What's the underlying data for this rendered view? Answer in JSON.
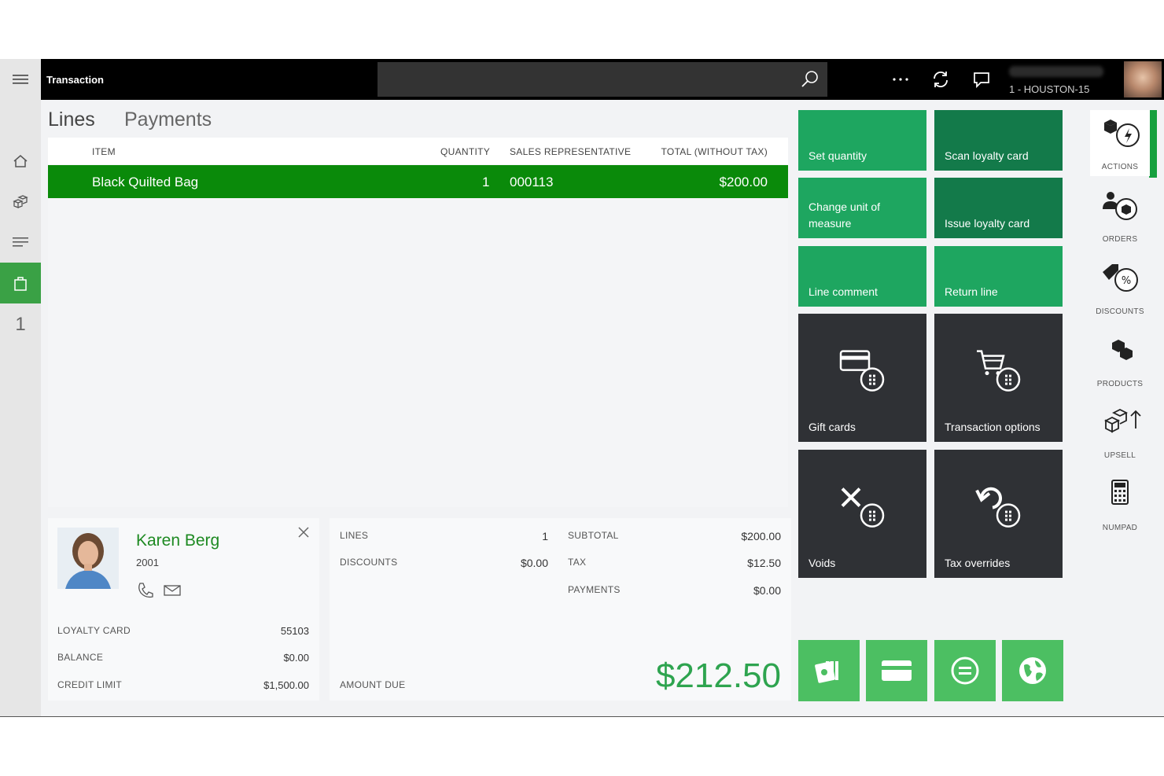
{
  "header": {
    "title": "Transaction",
    "search_value": "",
    "store_label": "1 - HOUSTON-15"
  },
  "tabs": [
    {
      "label": "Lines",
      "active": true
    },
    {
      "label": "Payments",
      "active": false
    }
  ],
  "grid": {
    "columns": [
      "ITEM",
      "QUANTITY",
      "SALES REPRESENTATIVE",
      "TOTAL (WITHOUT TAX)"
    ],
    "rows": [
      {
        "item": "Black Quilted Bag",
        "quantity": "1",
        "sales_rep": "000113",
        "total": "$200.00"
      }
    ]
  },
  "rail": {
    "cart_count": "1"
  },
  "customer": {
    "name": "Karen Berg",
    "id": "2001",
    "loyalty_card_label": "LOYALTY CARD",
    "loyalty_card_value": "55103",
    "balance_label": "BALANCE",
    "balance_value": "$0.00",
    "credit_limit_label": "CREDIT LIMIT",
    "credit_limit_value": "$1,500.00"
  },
  "totals": {
    "lines_label": "LINES",
    "lines_value": "1",
    "discounts_label": "DISCOUNTS",
    "discounts_value": "$0.00",
    "subtotal_label": "SUBTOTAL",
    "subtotal_value": "$200.00",
    "tax_label": "TAX",
    "tax_value": "$12.50",
    "payments_label": "PAYMENTS",
    "payments_value": "$0.00",
    "amount_due_label": "AMOUNT DUE",
    "amount_due_value": "$212.50"
  },
  "tiles": {
    "set_quantity": "Set quantity",
    "scan_loyalty": "Scan loyalty card",
    "change_uom": "Change unit of measure",
    "issue_loyalty": "Issue loyalty card",
    "line_comment": "Line comment",
    "return_line": "Return line",
    "gift_cards": "Gift cards",
    "transaction_options": "Transaction options",
    "voids": "Voids",
    "tax_overrides": "Tax overrides"
  },
  "payment_buttons": [
    "cash-icon",
    "card-icon",
    "equal-icon",
    "globe-icon"
  ],
  "side_panel": [
    {
      "label": "ACTIONS",
      "icon": "actions-icon",
      "active": true
    },
    {
      "label": "ORDERS",
      "icon": "orders-icon",
      "active": false
    },
    {
      "label": "DISCOUNTS",
      "icon": "discounts-icon",
      "active": false
    },
    {
      "label": "PRODUCTS",
      "icon": "products-icon",
      "active": false
    },
    {
      "label": "UPSELL",
      "icon": "upsell-icon",
      "active": false
    },
    {
      "label": "NUMPAD",
      "icon": "numpad-icon",
      "active": false
    }
  ],
  "colors": {
    "accent_green": "#0a8a0a",
    "tile_green_light": "#1ea660",
    "tile_green_dark": "#137a4a",
    "tile_dark": "#2f3135",
    "payment_green": "#4cbf62"
  }
}
